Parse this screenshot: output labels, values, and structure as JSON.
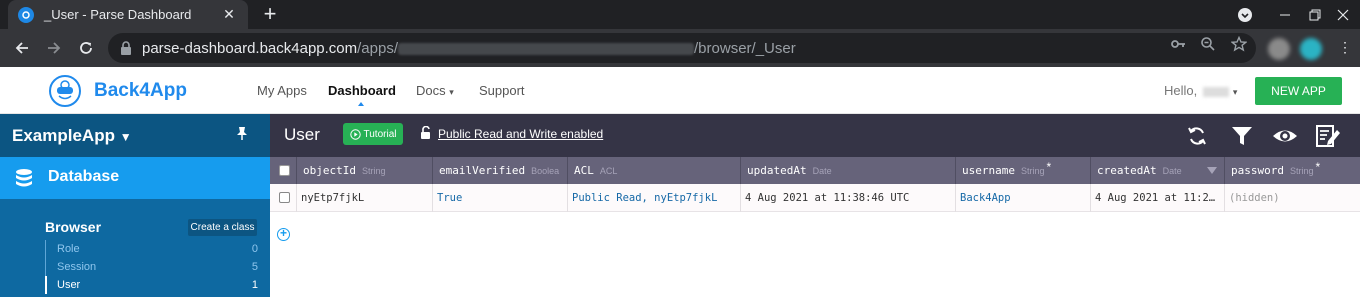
{
  "browser": {
    "tab_title": "_User - Parse Dashboard",
    "url_host": "parse-dashboard.back4app.com",
    "url_prefix": "/apps/",
    "url_suffix": "/browser/_User"
  },
  "header": {
    "brand": "Back4App",
    "nav": [
      {
        "label": "My Apps"
      },
      {
        "label": "Dashboard"
      },
      {
        "label": "Docs"
      },
      {
        "label": "Support"
      }
    ],
    "hello": "Hello,",
    "new_app": "NEW APP"
  },
  "sidebar": {
    "app_name": "ExampleApp",
    "database_label": "Database",
    "browser_label": "Browser",
    "create_class": "Create a class",
    "classes": [
      {
        "name": "Role",
        "count": "0"
      },
      {
        "name": "Session",
        "count": "5"
      },
      {
        "name": "User",
        "count": "1"
      }
    ]
  },
  "toolbar": {
    "title": "User",
    "tutorial": "Tutorial",
    "acl": "Public Read and Write enabled"
  },
  "table": {
    "columns": [
      {
        "name": "objectId",
        "type": "String"
      },
      {
        "name": "emailVerified",
        "type": "Boolea"
      },
      {
        "name": "ACL",
        "type": "ACL"
      },
      {
        "name": "updatedAt",
        "type": "Date"
      },
      {
        "name": "username",
        "type": "String"
      },
      {
        "name": "createdAt",
        "type": "Date"
      },
      {
        "name": "password",
        "type": "String"
      }
    ],
    "rows": [
      {
        "objectId": "nyEtp7fjkL",
        "emailVerified": "True",
        "ACL": "Public Read, nyEtp7fjkL",
        "updatedAt": "4 Aug 2021 at 11:38:46 UTC",
        "username": "Back4App",
        "createdAt": "4 Aug 2021 at 11:2…",
        "password": "(hidden)"
      }
    ]
  },
  "colors": {
    "brand_blue": "#208aec",
    "sidebar": "#0e69a1",
    "sidebar_active": "#169cee",
    "toolbar": "#353446",
    "header_row": "#66637a",
    "green": "#27b155"
  }
}
